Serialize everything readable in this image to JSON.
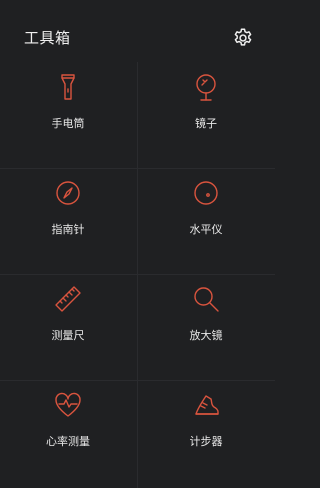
{
  "header": {
    "title": "工具箱",
    "settings_icon": "gear-icon"
  },
  "colors": {
    "background": "#1f2022",
    "accent": "#d9543e",
    "text": "#e8e8e8"
  },
  "tools": [
    {
      "id": "flashlight",
      "label": "手电筒",
      "icon": "flashlight-icon"
    },
    {
      "id": "mirror",
      "label": "镜子",
      "icon": "mirror-icon"
    },
    {
      "id": "compass",
      "label": "指南针",
      "icon": "compass-icon"
    },
    {
      "id": "level",
      "label": "水平仪",
      "icon": "level-icon"
    },
    {
      "id": "ruler",
      "label": "测量尺",
      "icon": "ruler-icon"
    },
    {
      "id": "magnifier",
      "label": "放大镜",
      "icon": "magnifier-icon"
    },
    {
      "id": "heart-rate",
      "label": "心率测量",
      "icon": "heart-rate-icon"
    },
    {
      "id": "pedometer",
      "label": "计步器",
      "icon": "shoe-icon"
    }
  ]
}
